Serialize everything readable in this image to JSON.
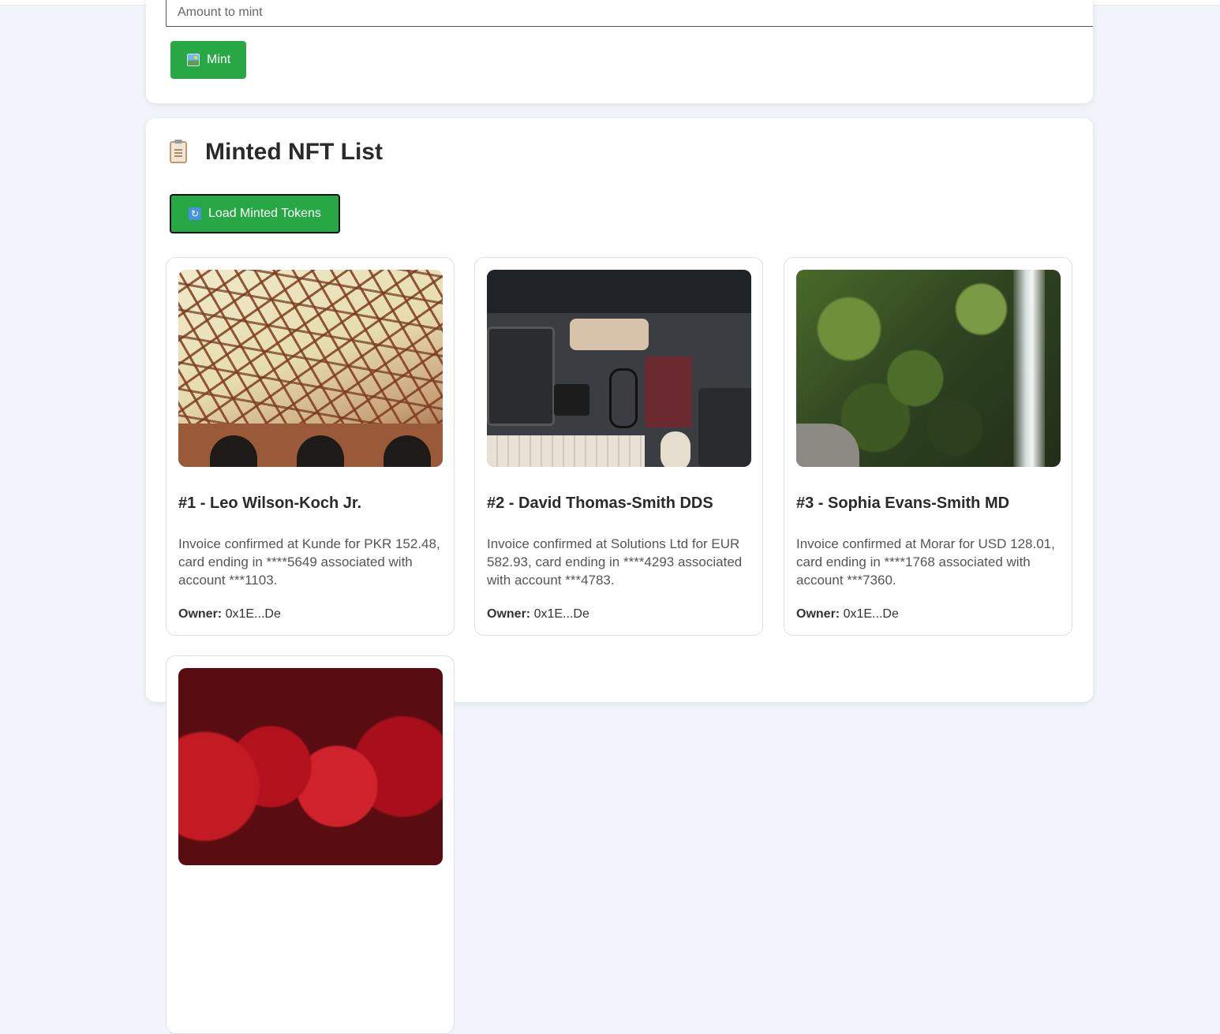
{
  "mint_form": {
    "amount_placeholder": "Amount to mint",
    "mint_button_label": "Mint",
    "mint_button_icon": "framed-picture-icon"
  },
  "nft_list": {
    "title": "Minted NFT List",
    "title_icon": "clipboard-icon",
    "load_button_label": "Load Minted Tokens",
    "load_button_icon": "refresh-icon",
    "owner_label": "Owner:",
    "items": [
      {
        "title": "#1 - Leo Wilson-Koch Jr.",
        "description": "Invoice confirmed at Kunde for PKR 152.48, card ending in ****5649 associated with account ***1103.",
        "owner": "0x1E...De",
        "image": "bridge-photo"
      },
      {
        "title": "#2 - David Thomas-Smith DDS",
        "description": "Invoice confirmed at Solutions Ltd for EUR 582.93, card ending in ****4293 associated with account ***4783.",
        "owner": "0x1E...De",
        "image": "desk-flatlay-photo"
      },
      {
        "title": "#3 - Sophia Evans-Smith MD",
        "description": "Invoice confirmed at Morar for USD 128.01, card ending in ****1768 associated with account ***7360.",
        "owner": "0x1E...De",
        "image": "waterfall-photo"
      },
      {
        "image": "strawberries-photo"
      }
    ]
  },
  "colors": {
    "page_background": "#f1f5fb",
    "button_green": "#28a745",
    "card_background": "#ffffff"
  }
}
